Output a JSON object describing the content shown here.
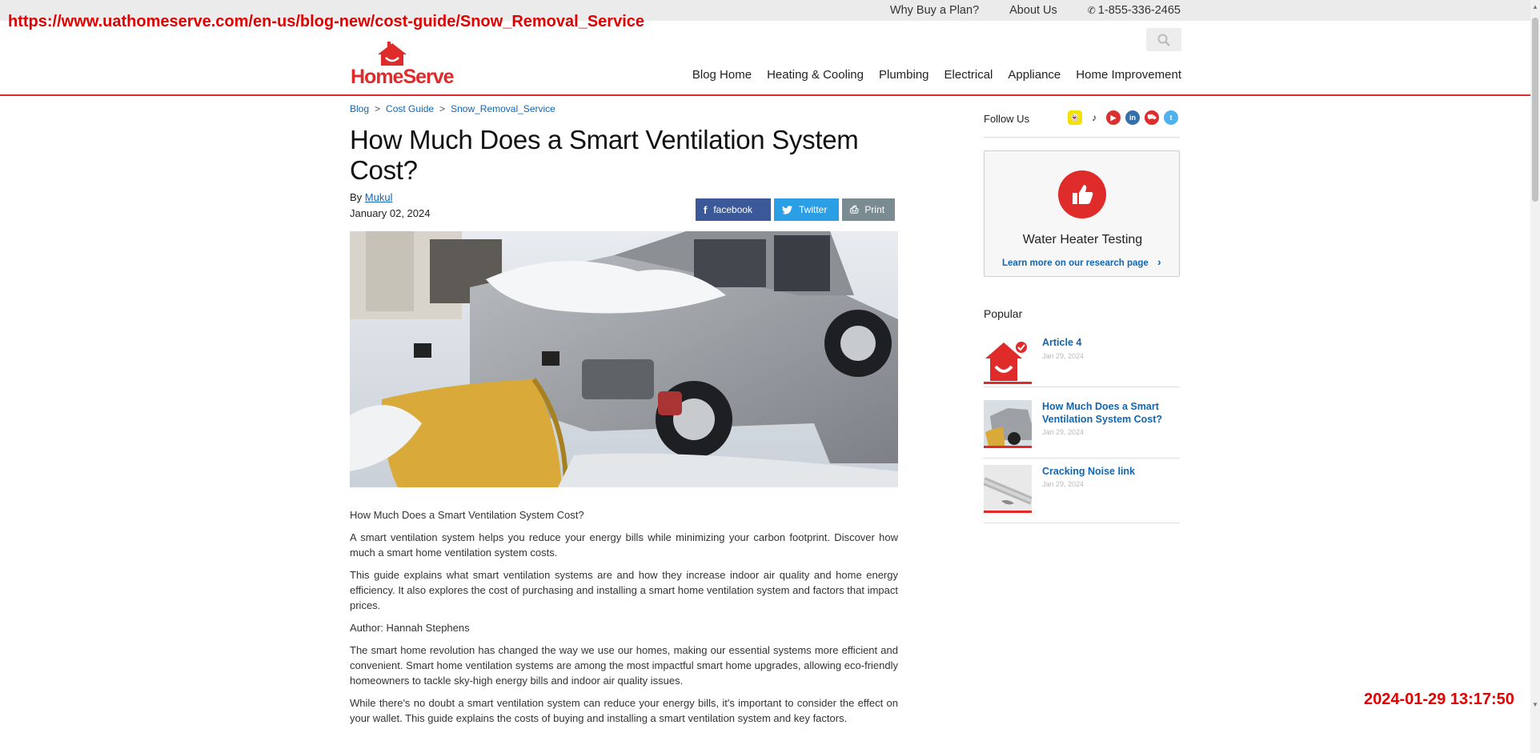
{
  "overlay": {
    "url": "https://www.uathomeserve.com/en-us/blog-new/cost-guide/Snow_Removal_Service",
    "timestamp": "2024-01-29 13:17:50"
  },
  "utility": {
    "why_buy": "Why Buy a Plan?",
    "about": "About Us",
    "phone": "1-855-336-2465"
  },
  "brand": {
    "name": "HomeServe",
    "color": "#e02b2b"
  },
  "nav": [
    "Blog Home",
    "Heating & Cooling",
    "Plumbing",
    "Electrical",
    "Appliance",
    "Home Improvement"
  ],
  "breadcrumb": [
    "Blog",
    "Cost Guide",
    "Snow_Removal_Service"
  ],
  "breadcrumb_sep": ">",
  "article": {
    "title": "How Much Does a Smart Ventilation System Cost?",
    "by_prefix": "By",
    "author_link": "Mukul",
    "date": "January 02, 2024",
    "share": {
      "facebook": "facebook",
      "twitter": "Twitter",
      "print": "Print"
    },
    "paragraphs": [
      "How Much Does a Smart Ventilation System Cost?",
      "A smart ventilation system helps you reduce your energy bills while minimizing your carbon footprint. Discover how much a smart home ventilation system costs.",
      "This guide explains what smart ventilation systems are and how they increase indoor air quality and home energy efficiency. It also explores the cost of purchasing and installing a smart home ventilation system and factors that impact prices.",
      "Author: Hannah Stephens",
      "The smart home revolution has changed the way we use our homes, making our essential systems more efficient and convenient. Smart home ventilation systems are among the most impactful smart home upgrades, allowing eco-friendly homeowners to tackle sky-high energy bills and indoor air quality issues.",
      "While there's no doubt a smart ventilation system can reduce your energy bills, it's important to consider the effect on your wallet. This guide explains the costs of buying and installing a smart ventilation system and key factors."
    ]
  },
  "sidebar": {
    "follow_label": "Follow Us",
    "social_icons": [
      "snapchat-icon",
      "tiktok-icon",
      "youtube-icon",
      "linkedin-icon",
      "truck-icon",
      "twitter-icon"
    ],
    "promo": {
      "title": "Water Heater Testing",
      "link": "Learn more on our research page"
    },
    "popular_label": "Popular",
    "popular": [
      {
        "title": "Article 4",
        "date": "Jan 29, 2024"
      },
      {
        "title": "How Much Does a Smart Ventilation System Cost?",
        "date": "Jan 29, 2024"
      },
      {
        "title": "Cracking Noise link",
        "date": "Jan 29, 2024"
      }
    ]
  }
}
